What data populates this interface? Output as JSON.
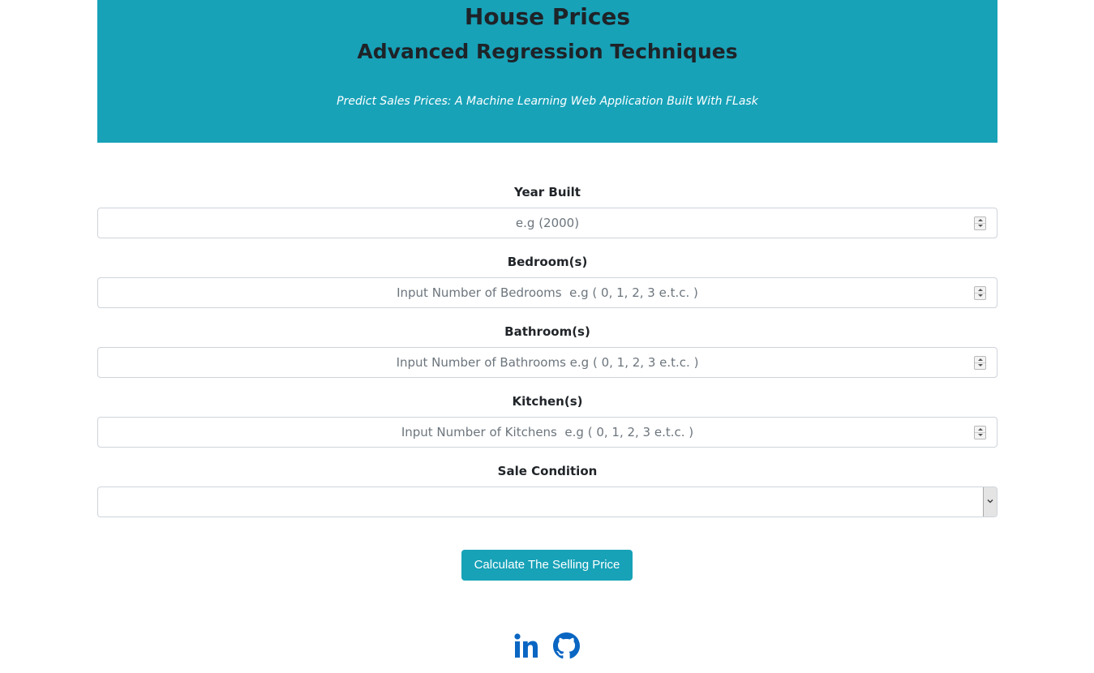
{
  "header": {
    "title": "House Prices",
    "subtitle": "Advanced Regression Techniques",
    "tagline": "Predict Sales Prices: A Machine Learning Web Application Built With FLask"
  },
  "form": {
    "fields": [
      {
        "label": "Year Built",
        "placeholder": "e.g (2000)"
      },
      {
        "label": "Bedroom(s)",
        "placeholder": "Input Number of Bedrooms  e.g ( 0, 1, 2, 3 e.t.c. )"
      },
      {
        "label": "Bathroom(s)",
        "placeholder": "Input Number of Bathrooms e.g ( 0, 1, 2, 3 e.t.c. )"
      },
      {
        "label": "Kitchen(s)",
        "placeholder": "Input Number of Kitchens  e.g ( 0, 1, 2, 3 e.t.c. )"
      }
    ],
    "sale_condition": {
      "label": "Sale Condition",
      "selected": ""
    },
    "submit_label": "Calculate The Selling Price"
  },
  "footer": {
    "social_icons": [
      "linkedin-icon",
      "github-icon"
    ]
  },
  "colors": {
    "accent": "#17a2b8",
    "title_text": "#1e2328",
    "social_icon": "#0a66c2"
  }
}
